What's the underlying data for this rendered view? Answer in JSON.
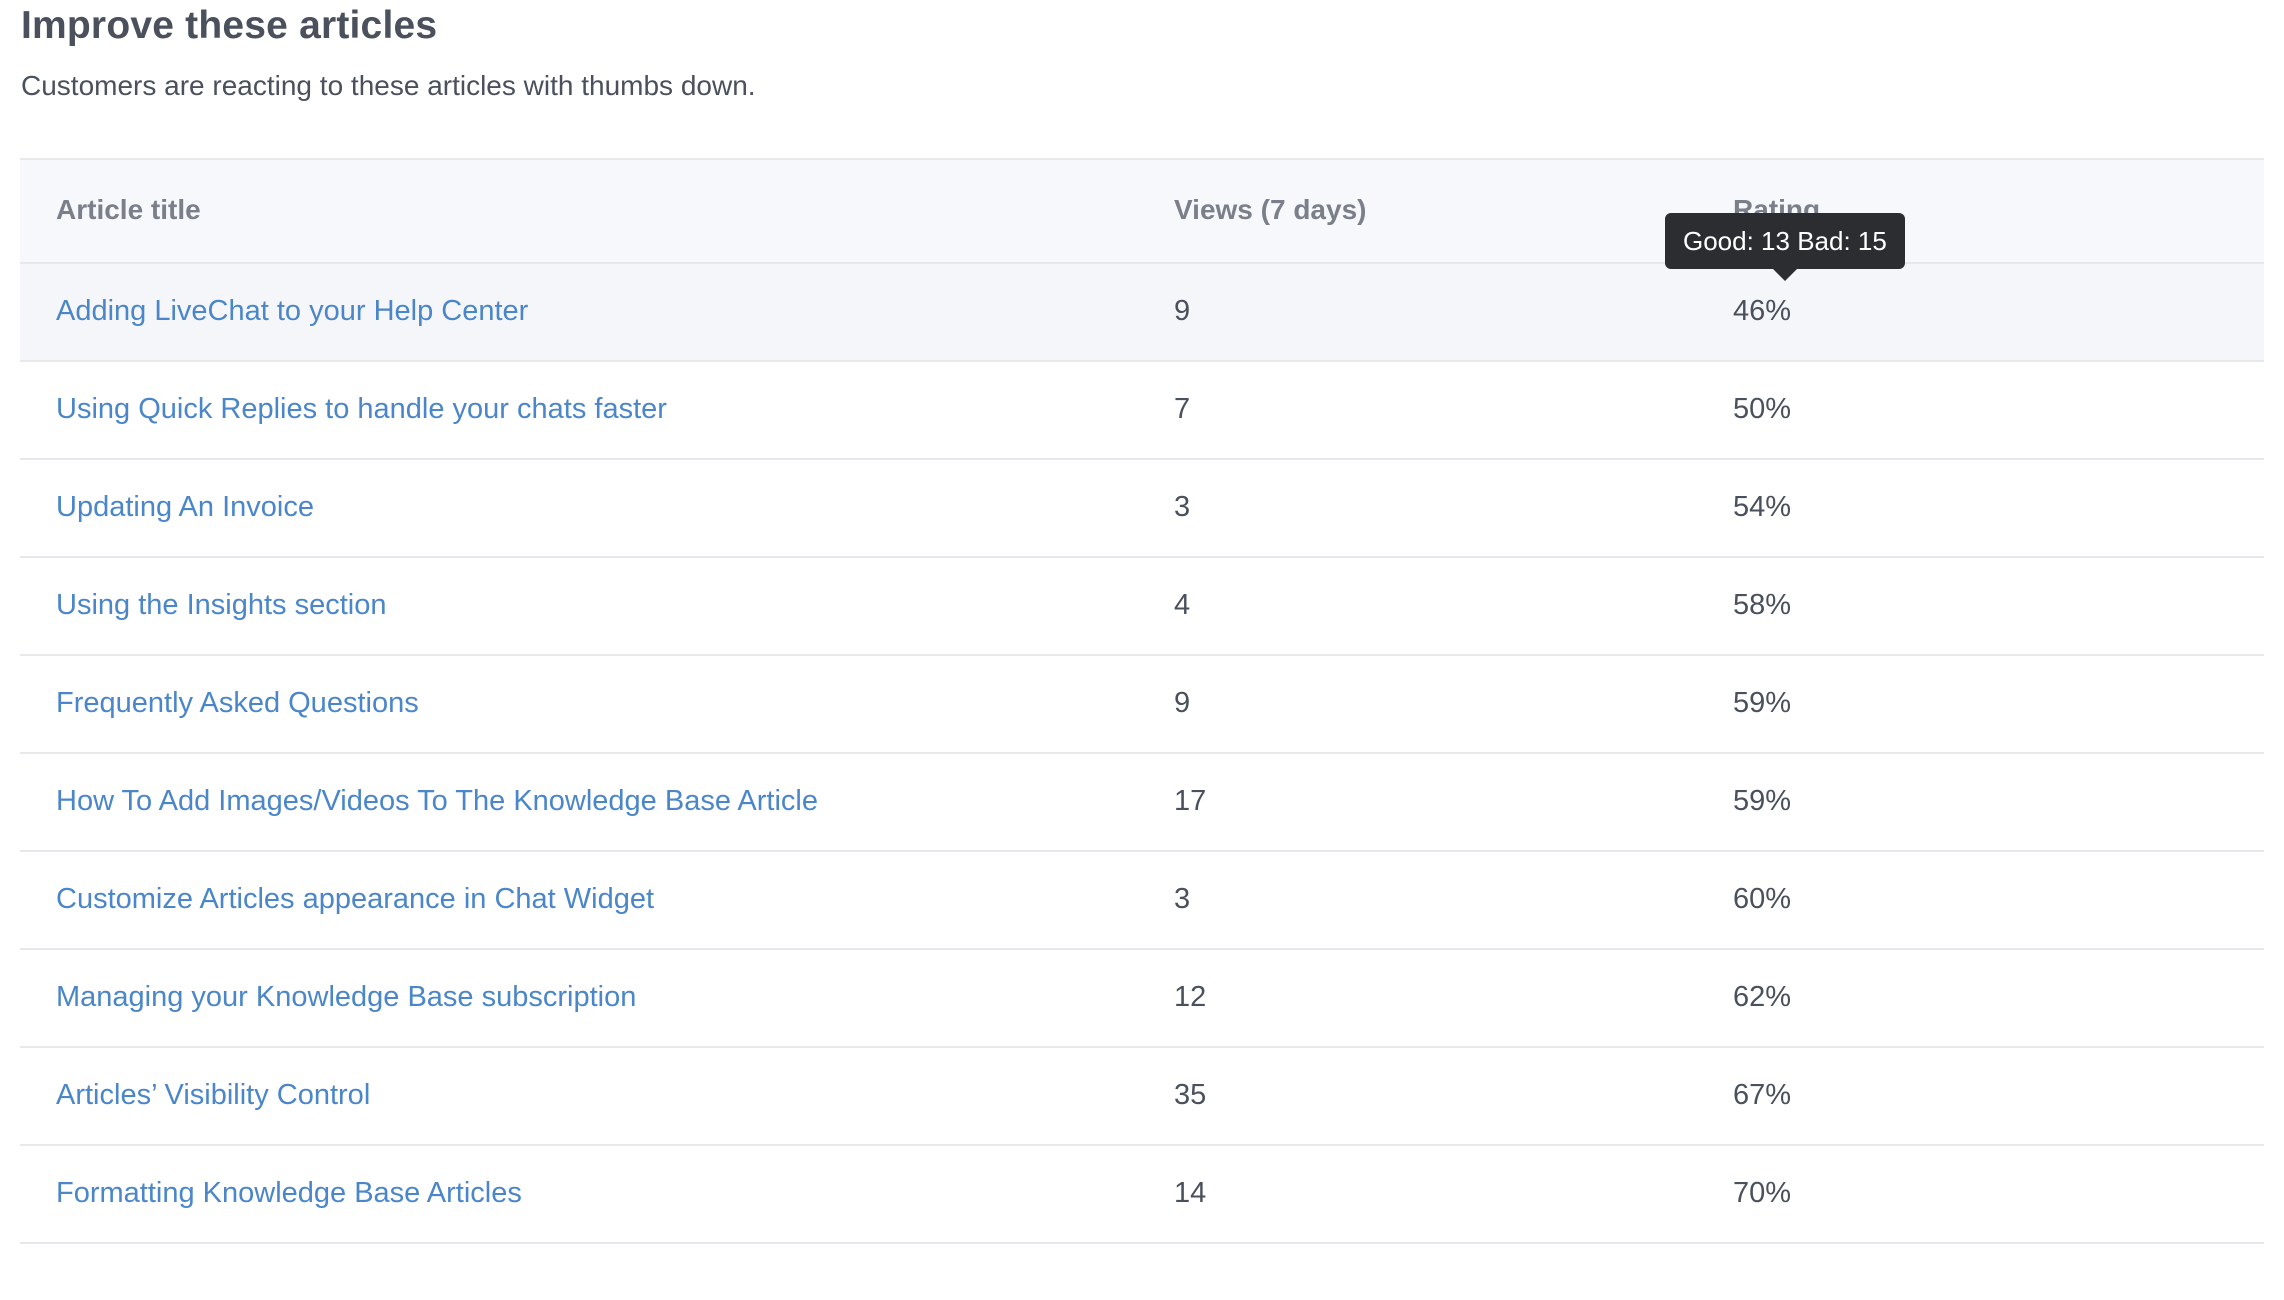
{
  "header": {
    "title": "Improve these articles",
    "subtitle": "Customers are reacting to these articles with thumbs down."
  },
  "table": {
    "columns": {
      "title": "Article title",
      "views": "Views (7 days)",
      "rating": "Rating"
    },
    "rows": [
      {
        "title": "Adding LiveChat to your Help Center",
        "views": "9",
        "rating": "46%"
      },
      {
        "title": "Using Quick Replies to handle your chats faster",
        "views": "7",
        "rating": "50%"
      },
      {
        "title": "Updating An Invoice",
        "views": "3",
        "rating": "54%"
      },
      {
        "title": "Using the Insights section",
        "views": "4",
        "rating": "58%"
      },
      {
        "title": "Frequently Asked Questions",
        "views": "9",
        "rating": "59%"
      },
      {
        "title": "How To Add Images/Videos To The Knowledge Base Article",
        "views": "17",
        "rating": "59%"
      },
      {
        "title": "Customize Articles appearance in Chat Widget",
        "views": "3",
        "rating": "60%"
      },
      {
        "title": "Managing your Knowledge Base subscription",
        "views": "12",
        "rating": "62%"
      },
      {
        "title": "Articles’ Visibility Control",
        "views": "35",
        "rating": "67%"
      },
      {
        "title": "Formatting Knowledge Base Articles",
        "views": "14",
        "rating": "70%"
      }
    ]
  },
  "tooltip": {
    "text": "Good: 13 Bad: 15"
  },
  "colors": {
    "link": "#4a86c9",
    "header_bg": "#f7f8fb",
    "tooltip_bg": "#2b2d31"
  }
}
